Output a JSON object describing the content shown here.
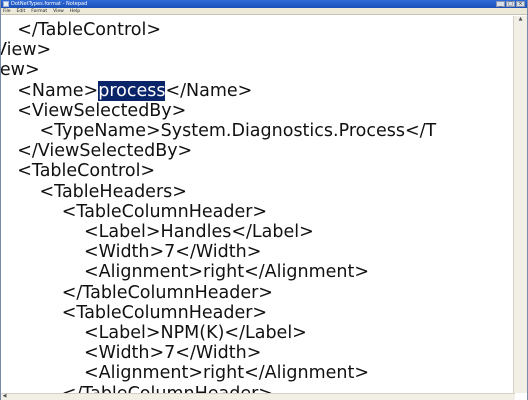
{
  "window": {
    "title": "DotNetTypes.format - Notepad",
    "controls": {
      "minimize": "_",
      "maximize": "□",
      "close": "×"
    }
  },
  "menu": [
    "File",
    "Edit",
    "Format",
    "View",
    "Help"
  ],
  "editor": {
    "lines": [
      {
        "text": "    </TableControl>"
      },
      {
        "text": "View>"
      },
      {
        "text": "iew>"
      },
      {
        "pre": "    <Name>",
        "sel": "process",
        "post": "</Name>"
      },
      {
        "text": "    <ViewSelectedBy>"
      },
      {
        "text": "        <TypeName>System.Diagnostics.Process</T"
      },
      {
        "text": "    </ViewSelectedBy>"
      },
      {
        "text": "    <TableControl>"
      },
      {
        "text": "        <TableHeaders>"
      },
      {
        "text": "            <TableColumnHeader>"
      },
      {
        "text": "                <Label>Handles</Label>"
      },
      {
        "text": "                <Width>7</Width>"
      },
      {
        "text": "                <Alignment>right</Alignment>"
      },
      {
        "text": "            </TableColumnHeader>"
      },
      {
        "text": "            <TableColumnHeader>"
      },
      {
        "text": "                <Label>NPM(K)</Label>"
      },
      {
        "text": "                <Width>7</Width>"
      },
      {
        "text": "                <Alignment>right</Alignment>"
      },
      {
        "text": "            </TableColumnHeader>"
      }
    ]
  },
  "icons": [
    "notepad-icon",
    "scroll-up-arrow-icon",
    "scroll-left-arrow-icon"
  ]
}
